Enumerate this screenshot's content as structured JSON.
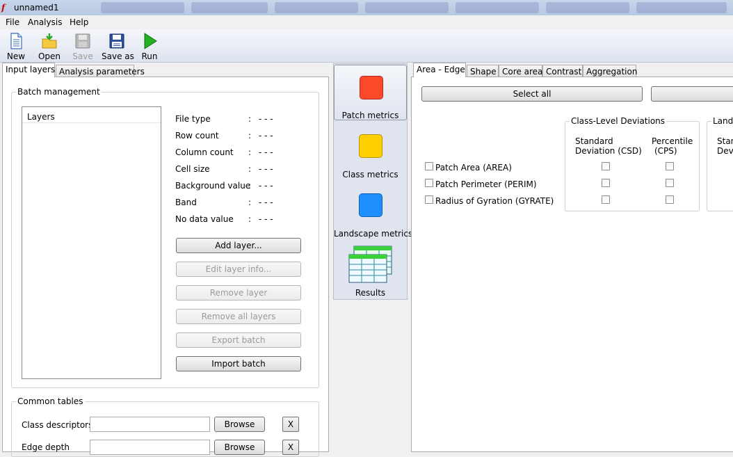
{
  "window": {
    "title": "unnamed1",
    "logo_text": "f",
    "logo_color": "#cc0000"
  },
  "menu": [
    "File",
    "Analysis",
    "Help"
  ],
  "toolbar": {
    "new_label": "New",
    "open_label": "Open",
    "save_label": "Save",
    "save_as_label": "Save as",
    "run_label": "Run"
  },
  "left_tabs": [
    "Input layers",
    "Analysis parameters"
  ],
  "batch": {
    "title": "Batch management",
    "layers_header": "Layers",
    "info": [
      {
        "label": "File type",
        "value": "- - -"
      },
      {
        "label": "Row count",
        "value": "- - -"
      },
      {
        "label": "Column count",
        "value": "- - -"
      },
      {
        "label": "Cell size",
        "value": "- - -"
      },
      {
        "label": "Background value",
        "value": "- - -"
      },
      {
        "label": "Band",
        "value": "- - -"
      },
      {
        "label": "No data value",
        "value": "- - -"
      }
    ],
    "colon": ":",
    "buttons": {
      "add_layer": "Add layer...",
      "edit_layer_info": "Edit layer info...",
      "remove_layer": "Remove layer",
      "remove_all_layers": "Remove all layers",
      "export_batch": "Export batch",
      "import_batch": "Import batch"
    }
  },
  "common_tables": {
    "title": "Common tables",
    "class_descriptors_label": "Class descriptors",
    "edge_depth_label": "Edge depth",
    "browse_label": "Browse",
    "clear_label": "X"
  },
  "nav": {
    "patch_metrics": "Patch metrics",
    "class_metrics": "Class metrics",
    "landscape_metrics": "Landscape metrics",
    "results": "Results",
    "patch_color": "#ff4a2a",
    "class_color": "#ffd000",
    "landscape_color": "#1e8fff"
  },
  "right_tabs": [
    "Area - Edge",
    "Shape",
    "Core area",
    "Contrast",
    "Aggregation"
  ],
  "area_edge": {
    "select_all_label": "Select all",
    "class_deviations_title": "Class-Level Deviations",
    "landscape_deviations_title": "Lands",
    "std_dev_line1": "Standard",
    "std_dev_line2": "Deviation  (CSD)",
    "percentile_line1": "Percentile",
    "percentile_line2": "(CPS)",
    "landscape_std_line1": "Stan",
    "landscape_std_line2": "Devi",
    "metrics": [
      {
        "label": "Patch Area  (AREA)"
      },
      {
        "label": "Patch Perimeter  (PERIM)"
      },
      {
        "label": "Radius of Gyration  (GYRATE)"
      }
    ]
  }
}
